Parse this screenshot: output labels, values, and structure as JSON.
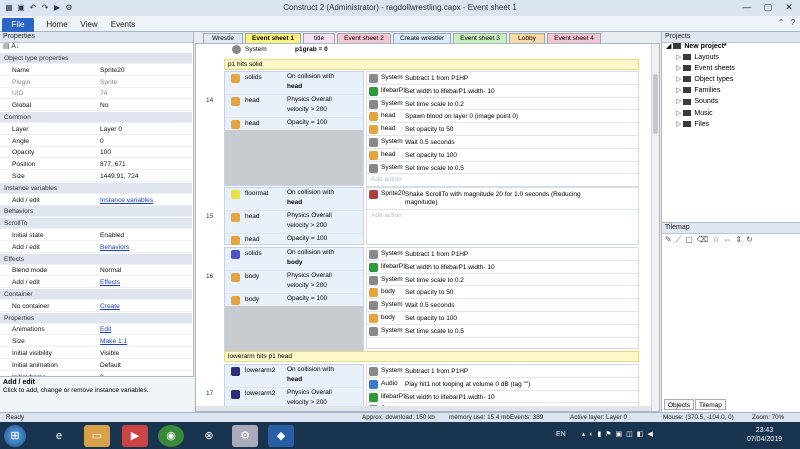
{
  "window": {
    "title": "Construct 2 (Administrator) - ragdollwrestling.capx - Event sheet 1",
    "controls": [
      "minimize-icon",
      "maximize-icon",
      "close-icon"
    ]
  },
  "ribbon": {
    "tabs": [
      "File",
      "Home",
      "View",
      "Events"
    ]
  },
  "properties": {
    "header": "Properties",
    "rows": [
      {
        "type": "section",
        "k": "Object type properties"
      },
      {
        "k": "Name",
        "v": "Sprite20"
      },
      {
        "k": "Plugin",
        "v": "Sprite",
        "dim": true
      },
      {
        "k": "UID",
        "v": "74",
        "dim": true
      },
      {
        "k": "Global",
        "v": "No"
      },
      {
        "type": "section",
        "k": "Common"
      },
      {
        "k": "Layer",
        "v": "Layer 0"
      },
      {
        "k": "Angle",
        "v": "0"
      },
      {
        "k": "Opacity",
        "v": "100"
      },
      {
        "k": "Position",
        "v": "877, 671"
      },
      {
        "k": "Size",
        "v": "1449.91, 724"
      },
      {
        "type": "section",
        "k": "Instance variables"
      },
      {
        "k": "Add / edit",
        "v": "Instance variables",
        "link": true
      },
      {
        "type": "section",
        "k": "Behaviors"
      },
      {
        "type": "section",
        "k": "ScrollTo"
      },
      {
        "k": "Initial state",
        "v": "Enabled"
      },
      {
        "k": "Add / edit",
        "v": "Behaviors",
        "link": true
      },
      {
        "type": "section",
        "k": "Effects"
      },
      {
        "k": "Blend mode",
        "v": "Normal"
      },
      {
        "k": "Add / edit",
        "v": "Effects",
        "link": true
      },
      {
        "type": "section",
        "k": "Container"
      },
      {
        "k": "No container",
        "v": "Create",
        "link": true
      },
      {
        "type": "section",
        "k": "Properties"
      },
      {
        "k": "Animations",
        "v": "Edit",
        "link": true
      },
      {
        "k": "Size",
        "v": "Make 1:1",
        "link": true
      },
      {
        "k": "Initial visibility",
        "v": "Visible"
      },
      {
        "k": "Initial animation",
        "v": "Default"
      },
      {
        "k": "Initial frame",
        "v": "0"
      },
      {
        "k": "Collisions",
        "v": "Enabled"
      }
    ],
    "help_title": "Add / edit",
    "help_text": "Click to add, change or remove instance variables."
  },
  "sheet_tabs": [
    {
      "label": "Wrestle",
      "color": "#dfe8f3"
    },
    {
      "label": "Event sheet 1",
      "color": "#fff27a"
    },
    {
      "label": "title",
      "color": "#f8e0f0"
    },
    {
      "label": "Event sheet 2",
      "color": "#f6c6d0"
    },
    {
      "label": "Create wrestler",
      "color": "#d9ecff"
    },
    {
      "label": "Event sheet 3",
      "color": "#c9f0c0"
    },
    {
      "label": "Lobby",
      "color": "#ffd8a8"
    },
    {
      "label": "Event sheet 4",
      "color": "#f6c6d0"
    }
  ],
  "events": {
    "top_row": {
      "obj": "System",
      "txt": "p1grab = 0"
    },
    "c1": "p1 hits solid",
    "e14": {
      "num": "14",
      "conds": [
        {
          "obj": "solids",
          "txt": "On collision with",
          "bold": "head",
          "ico": "#e8a43c"
        },
        {
          "obj": "head",
          "txt": "Physics Overall",
          "txt2": "velocity > 200",
          "ico": "#e8a43c"
        },
        {
          "obj": "head",
          "txt": "Opacity = 100",
          "ico": "#e8a43c"
        }
      ],
      "acts": [
        {
          "obj": "System",
          "txt": "Subtract 1 from P1HP",
          "ico": "#888"
        },
        {
          "obj": "lifebarP1",
          "txt": "Set width to lifebarP1.width- 10",
          "ico": "#2d9a3a"
        },
        {
          "obj": "System",
          "txt": "Set time scale to 0.2",
          "ico": "#888"
        },
        {
          "obj": "head",
          "txt": "Spawn  blood on layer 0 (image point 0)",
          "ico": "#e8a43c"
        },
        {
          "obj": "head",
          "txt": "Set opacity to 50",
          "ico": "#e8a43c"
        },
        {
          "obj": "System",
          "txt": "Wait 0.5 seconds",
          "ico": "#888"
        },
        {
          "obj": "head",
          "txt": "Set opacity to 100",
          "ico": "#e8a43c"
        },
        {
          "obj": "System",
          "txt": "Set time scale to 0.5",
          "ico": "#888"
        }
      ],
      "add_action": "Add action"
    },
    "e15": {
      "num": "15",
      "conds": [
        {
          "obj": "floormat",
          "txt": "On collision with",
          "bold": "head",
          "ico": "#e8e23c"
        },
        {
          "obj": "head",
          "txt": "Physics Overall",
          "txt2": "velocity > 200",
          "ico": "#e8a43c"
        },
        {
          "obj": "head",
          "txt": "Opacity = 100",
          "ico": "#e8a43c"
        }
      ],
      "acts": [
        {
          "obj": "Sprite20",
          "txt": "Shake  ScrollTo with magnitude 20 for 1.0 seconds (Reducing",
          "txt2": "magnitude)",
          "ico": "#b04040"
        }
      ],
      "add_action": "Add action"
    },
    "e16": {
      "num": "16",
      "conds": [
        {
          "obj": "solids",
          "txt": "On collision with",
          "bold": "body",
          "ico": "#4a57c8"
        },
        {
          "obj": "body",
          "txt": "Physics Overall",
          "txt2": "velocity > 200",
          "ico": "#e8a43c"
        },
        {
          "obj": "body",
          "txt": "Opacity = 100",
          "ico": "#e8a43c"
        }
      ],
      "acts": [
        {
          "obj": "System",
          "txt": "Subtract 1 from P1HP",
          "ico": "#888"
        },
        {
          "obj": "lifebarP1",
          "txt": "Set width to lifebarP1.width- 10",
          "ico": "#2d9a3a"
        },
        {
          "obj": "System",
          "txt": "Set time scale to 0.2",
          "ico": "#888"
        },
        {
          "obj": "body",
          "txt": "Set opacity to 50",
          "ico": "#e8a43c"
        },
        {
          "obj": "System",
          "txt": "Wait 0.5 seconds",
          "ico": "#888"
        },
        {
          "obj": "body",
          "txt": "Set opacity to 100",
          "ico": "#e8a43c"
        },
        {
          "obj": "System",
          "txt": "Set time scale to 0.5",
          "ico": "#888"
        }
      ]
    },
    "c2": "lowerarm hits p1 head",
    "e17": {
      "num": "17",
      "conds": [
        {
          "obj": "lowerarm2",
          "txt": "On collision with",
          "bold": "head",
          "ico": "#2a2f7a"
        },
        {
          "obj": "lowerarm2",
          "txt": "Physics Overall",
          "txt2": "velocity > 200",
          "ico": "#2a2f7a"
        }
      ],
      "acts": [
        {
          "obj": "System",
          "txt": "Subtract 1 from P1HP",
          "ico": "#888"
        },
        {
          "obj": "Audio",
          "txt": "Play hit1 not looping at volume 0 dB (tag \"\")",
          "ico": "#3a78c8"
        },
        {
          "obj": "lifebarP1",
          "txt": "Set width to lifebarP1.width- 10",
          "ico": "#2d9a3a"
        },
        {
          "obj": "System",
          "txt": "Set time scale to 0.2",
          "ico": "#888"
        }
      ]
    }
  },
  "projects": {
    "header": "Projects",
    "root": "New project*",
    "items": [
      "Layouts",
      "Event sheets",
      "Object types",
      "Families",
      "Sounds",
      "Music",
      "Files"
    ]
  },
  "tilemap": {
    "header": "Tilemap",
    "tabs": [
      "Objects",
      "Tilemap"
    ]
  },
  "status": {
    "left": "Ready",
    "download": "Approx. download: 150 kb",
    "memory": "memory use: 15.4 mb",
    "events": "Events: 389",
    "layer": "Active layer: Layer 0",
    "mouse": "Mouse: (370.5, -104.0, 0)",
    "zoom": "Zoom: 70%"
  },
  "taskbar": {
    "lang": "EN",
    "time": "23:43",
    "date": "07/04/2019"
  }
}
